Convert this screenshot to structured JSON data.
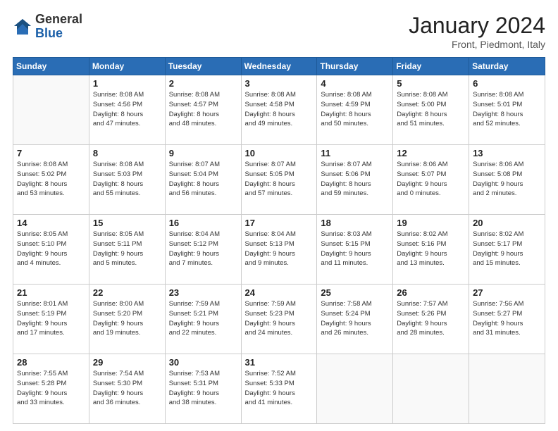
{
  "logo": {
    "general": "General",
    "blue": "Blue"
  },
  "header": {
    "month": "January 2024",
    "location": "Front, Piedmont, Italy"
  },
  "weekdays": [
    "Sunday",
    "Monday",
    "Tuesday",
    "Wednesday",
    "Thursday",
    "Friday",
    "Saturday"
  ],
  "weeks": [
    [
      {
        "day": "",
        "info": ""
      },
      {
        "day": "1",
        "info": "Sunrise: 8:08 AM\nSunset: 4:56 PM\nDaylight: 8 hours\nand 47 minutes."
      },
      {
        "day": "2",
        "info": "Sunrise: 8:08 AM\nSunset: 4:57 PM\nDaylight: 8 hours\nand 48 minutes."
      },
      {
        "day": "3",
        "info": "Sunrise: 8:08 AM\nSunset: 4:58 PM\nDaylight: 8 hours\nand 49 minutes."
      },
      {
        "day": "4",
        "info": "Sunrise: 8:08 AM\nSunset: 4:59 PM\nDaylight: 8 hours\nand 50 minutes."
      },
      {
        "day": "5",
        "info": "Sunrise: 8:08 AM\nSunset: 5:00 PM\nDaylight: 8 hours\nand 51 minutes."
      },
      {
        "day": "6",
        "info": "Sunrise: 8:08 AM\nSunset: 5:01 PM\nDaylight: 8 hours\nand 52 minutes."
      }
    ],
    [
      {
        "day": "7",
        "info": "Sunrise: 8:08 AM\nSunset: 5:02 PM\nDaylight: 8 hours\nand 53 minutes."
      },
      {
        "day": "8",
        "info": "Sunrise: 8:08 AM\nSunset: 5:03 PM\nDaylight: 8 hours\nand 55 minutes."
      },
      {
        "day": "9",
        "info": "Sunrise: 8:07 AM\nSunset: 5:04 PM\nDaylight: 8 hours\nand 56 minutes."
      },
      {
        "day": "10",
        "info": "Sunrise: 8:07 AM\nSunset: 5:05 PM\nDaylight: 8 hours\nand 57 minutes."
      },
      {
        "day": "11",
        "info": "Sunrise: 8:07 AM\nSunset: 5:06 PM\nDaylight: 8 hours\nand 59 minutes."
      },
      {
        "day": "12",
        "info": "Sunrise: 8:06 AM\nSunset: 5:07 PM\nDaylight: 9 hours\nand 0 minutes."
      },
      {
        "day": "13",
        "info": "Sunrise: 8:06 AM\nSunset: 5:08 PM\nDaylight: 9 hours\nand 2 minutes."
      }
    ],
    [
      {
        "day": "14",
        "info": "Sunrise: 8:05 AM\nSunset: 5:10 PM\nDaylight: 9 hours\nand 4 minutes."
      },
      {
        "day": "15",
        "info": "Sunrise: 8:05 AM\nSunset: 5:11 PM\nDaylight: 9 hours\nand 5 minutes."
      },
      {
        "day": "16",
        "info": "Sunrise: 8:04 AM\nSunset: 5:12 PM\nDaylight: 9 hours\nand 7 minutes."
      },
      {
        "day": "17",
        "info": "Sunrise: 8:04 AM\nSunset: 5:13 PM\nDaylight: 9 hours\nand 9 minutes."
      },
      {
        "day": "18",
        "info": "Sunrise: 8:03 AM\nSunset: 5:15 PM\nDaylight: 9 hours\nand 11 minutes."
      },
      {
        "day": "19",
        "info": "Sunrise: 8:02 AM\nSunset: 5:16 PM\nDaylight: 9 hours\nand 13 minutes."
      },
      {
        "day": "20",
        "info": "Sunrise: 8:02 AM\nSunset: 5:17 PM\nDaylight: 9 hours\nand 15 minutes."
      }
    ],
    [
      {
        "day": "21",
        "info": "Sunrise: 8:01 AM\nSunset: 5:19 PM\nDaylight: 9 hours\nand 17 minutes."
      },
      {
        "day": "22",
        "info": "Sunrise: 8:00 AM\nSunset: 5:20 PM\nDaylight: 9 hours\nand 19 minutes."
      },
      {
        "day": "23",
        "info": "Sunrise: 7:59 AM\nSunset: 5:21 PM\nDaylight: 9 hours\nand 22 minutes."
      },
      {
        "day": "24",
        "info": "Sunrise: 7:59 AM\nSunset: 5:23 PM\nDaylight: 9 hours\nand 24 minutes."
      },
      {
        "day": "25",
        "info": "Sunrise: 7:58 AM\nSunset: 5:24 PM\nDaylight: 9 hours\nand 26 minutes."
      },
      {
        "day": "26",
        "info": "Sunrise: 7:57 AM\nSunset: 5:26 PM\nDaylight: 9 hours\nand 28 minutes."
      },
      {
        "day": "27",
        "info": "Sunrise: 7:56 AM\nSunset: 5:27 PM\nDaylight: 9 hours\nand 31 minutes."
      }
    ],
    [
      {
        "day": "28",
        "info": "Sunrise: 7:55 AM\nSunset: 5:28 PM\nDaylight: 9 hours\nand 33 minutes."
      },
      {
        "day": "29",
        "info": "Sunrise: 7:54 AM\nSunset: 5:30 PM\nDaylight: 9 hours\nand 36 minutes."
      },
      {
        "day": "30",
        "info": "Sunrise: 7:53 AM\nSunset: 5:31 PM\nDaylight: 9 hours\nand 38 minutes."
      },
      {
        "day": "31",
        "info": "Sunrise: 7:52 AM\nSunset: 5:33 PM\nDaylight: 9 hours\nand 41 minutes."
      },
      {
        "day": "",
        "info": ""
      },
      {
        "day": "",
        "info": ""
      },
      {
        "day": "",
        "info": ""
      }
    ]
  ]
}
